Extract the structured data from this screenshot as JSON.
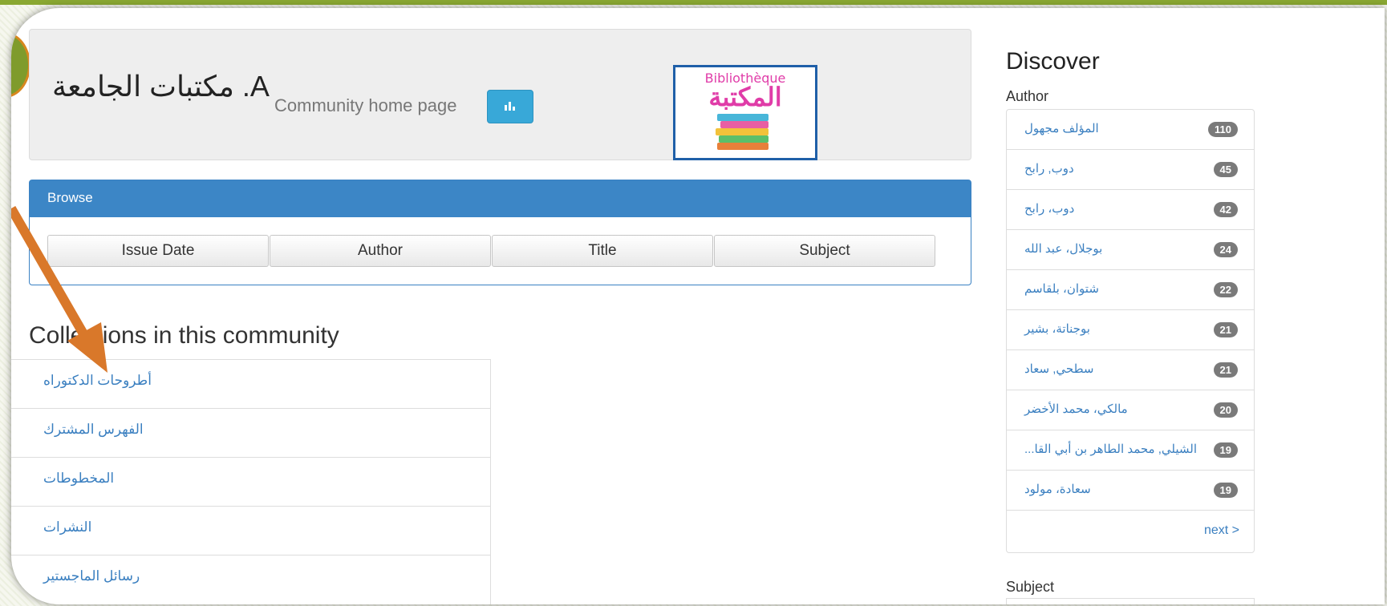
{
  "hero": {
    "title": "مكتبات الجامعة .A",
    "subtitle": "Community home page",
    "logo_small": "Bibliothèque",
    "logo_big": "المكتبة"
  },
  "browse": {
    "heading": "Browse",
    "buttons": [
      "Issue Date",
      "Author",
      "Title",
      "Subject"
    ]
  },
  "collections": {
    "heading": "Collections in this community",
    "items": [
      "أطروحات الدكتوراه",
      "الفهرس المشترك",
      "المخطوطات",
      "النشرات",
      "رسائل الماجستير"
    ]
  },
  "discover": {
    "title": "Discover",
    "author_label": "Author",
    "authors": [
      {
        "name": "المؤلف مجهول",
        "count": "110"
      },
      {
        "name": "دوب, رابح",
        "count": "45"
      },
      {
        "name": "دوب، رابح",
        "count": "42"
      },
      {
        "name": "بوجلال، عبد الله",
        "count": "24"
      },
      {
        "name": "شتوان، بلقاسم",
        "count": "22"
      },
      {
        "name": "بوجناتة، بشير",
        "count": "21"
      },
      {
        "name": "سطحي, سعاد",
        "count": "21"
      },
      {
        "name": "مالكي، محمد الأخضر",
        "count": "20"
      },
      {
        "name": "...الشيلي, محمد الطاهر بن أبي القا",
        "count": "19"
      },
      {
        "name": "سعادة، مولود",
        "count": "19"
      }
    ],
    "next": "next >",
    "subject_label": "Subject"
  },
  "colors": {
    "accent_blue": "#3c86c6",
    "link_blue": "#3a7fc0",
    "frame_green": "#8aa832",
    "arrow_orange": "#d9782a"
  }
}
